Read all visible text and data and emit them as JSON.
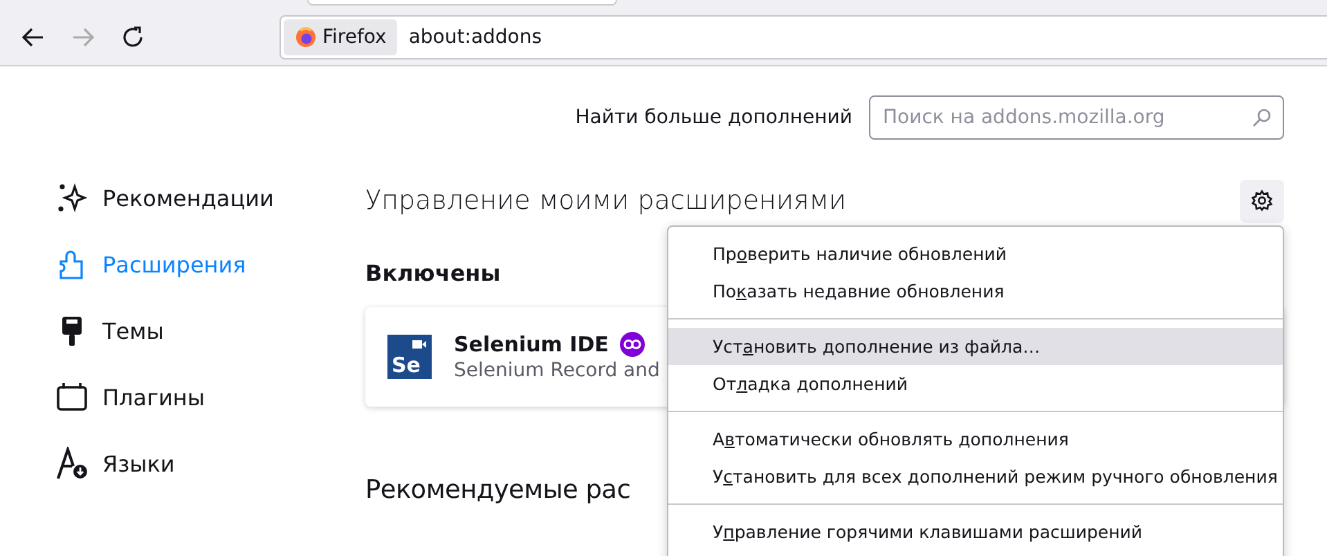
{
  "toolbar": {
    "back_disabled": false,
    "forward_disabled": true,
    "identity": "Firefox",
    "url": "about:addons"
  },
  "find_more": {
    "label": "Найти больше дополнений",
    "placeholder": "Поиск на addons.mozilla.org"
  },
  "sidebar": {
    "items": [
      {
        "kind": "recommendations",
        "label": "Рекомендации",
        "selected": false
      },
      {
        "kind": "extensions",
        "label": "Расширения",
        "selected": true
      },
      {
        "kind": "themes",
        "label": "Темы",
        "selected": false
      },
      {
        "kind": "plugins",
        "label": "Плагины",
        "selected": false
      },
      {
        "kind": "languages",
        "label": "Языки",
        "selected": false
      }
    ]
  },
  "main": {
    "title": "Управление моими расширениями",
    "section": "Включены",
    "addons": [
      {
        "logo_text": "Se",
        "name": "Selenium IDE",
        "description": "Selenium Record and",
        "recommended": true
      }
    ],
    "recommended_title": "Рекомендуемые рас"
  },
  "menu": {
    "groups": [
      [
        {
          "before": "Пр",
          "key": "о",
          "after": "верить наличие обновлений",
          "selected": false
        },
        {
          "before": "По",
          "key": "к",
          "after": "азать недавние обновления",
          "selected": false
        }
      ],
      [
        {
          "before": "Уст",
          "key": "а",
          "after": "новить дополнение из файла…",
          "selected": true
        },
        {
          "before": "От",
          "key": "л",
          "after": "адка дополнений",
          "selected": false
        }
      ],
      [
        {
          "before": "А",
          "key": "в",
          "after": "томатически обновлять дополнения",
          "selected": false
        },
        {
          "before": "У",
          "key": "с",
          "after": "тановить для всех дополнений режим ручного обновления",
          "selected": false
        }
      ],
      [
        {
          "before": "У",
          "key": "п",
          "after": "равление горячими клавишами расширений",
          "selected": false
        }
      ]
    ]
  }
}
